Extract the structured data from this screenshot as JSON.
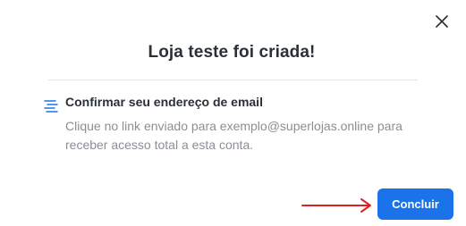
{
  "dialog": {
    "title": "Loja teste foi criada!",
    "close_icon": "close-icon"
  },
  "step": {
    "icon": "email-lines-icon",
    "heading": "Confirmar seu endereço de email",
    "body": "Clique no link enviado para exemplo@superlojas.online para receber acesso total a esta conta."
  },
  "footer": {
    "annotation_arrow": "red-arrow-icon",
    "confirm_label": "Concluir"
  },
  "colors": {
    "primary": "#1a73e8",
    "title": "#2b2f36",
    "muted": "#8a8f96",
    "arrow": "#e02020",
    "icon": "#1a73e8"
  }
}
